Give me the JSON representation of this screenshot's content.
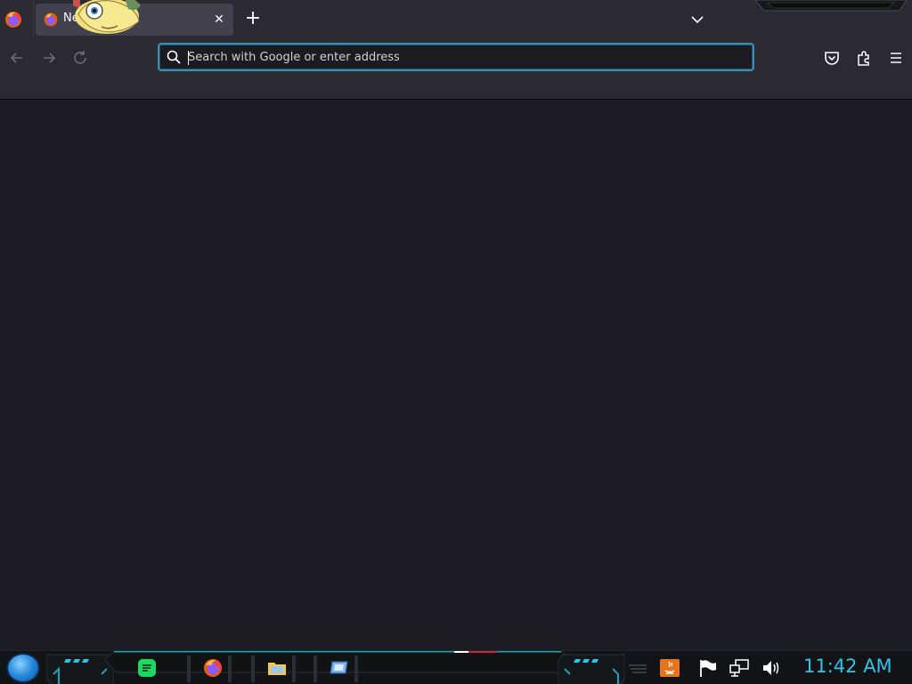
{
  "browser": {
    "tabs": [
      {
        "title": "New Tab",
        "active": true
      }
    ],
    "url_placeholder": "Search with Google or enter address",
    "url_value": "",
    "toolbar_icons": [
      "back-icon",
      "forward-icon",
      "reload-icon",
      "pocket-icon",
      "extensions-icon",
      "menu-icon"
    ]
  },
  "taskbar": {
    "apps": [
      "spotify-icon",
      "firefox-icon",
      "file-manager-icon",
      "virtual-desktop-icon"
    ],
    "tray_icons": [
      "java-update-icon",
      "action-center-flag-icon",
      "network-icon",
      "volume-icon"
    ],
    "clock": "11:42 AM"
  },
  "colors": {
    "chrome": "#2b2a33",
    "content": "#1c1b22",
    "url_focus": "#3c8bb0",
    "clock": "#2ec4e6"
  }
}
